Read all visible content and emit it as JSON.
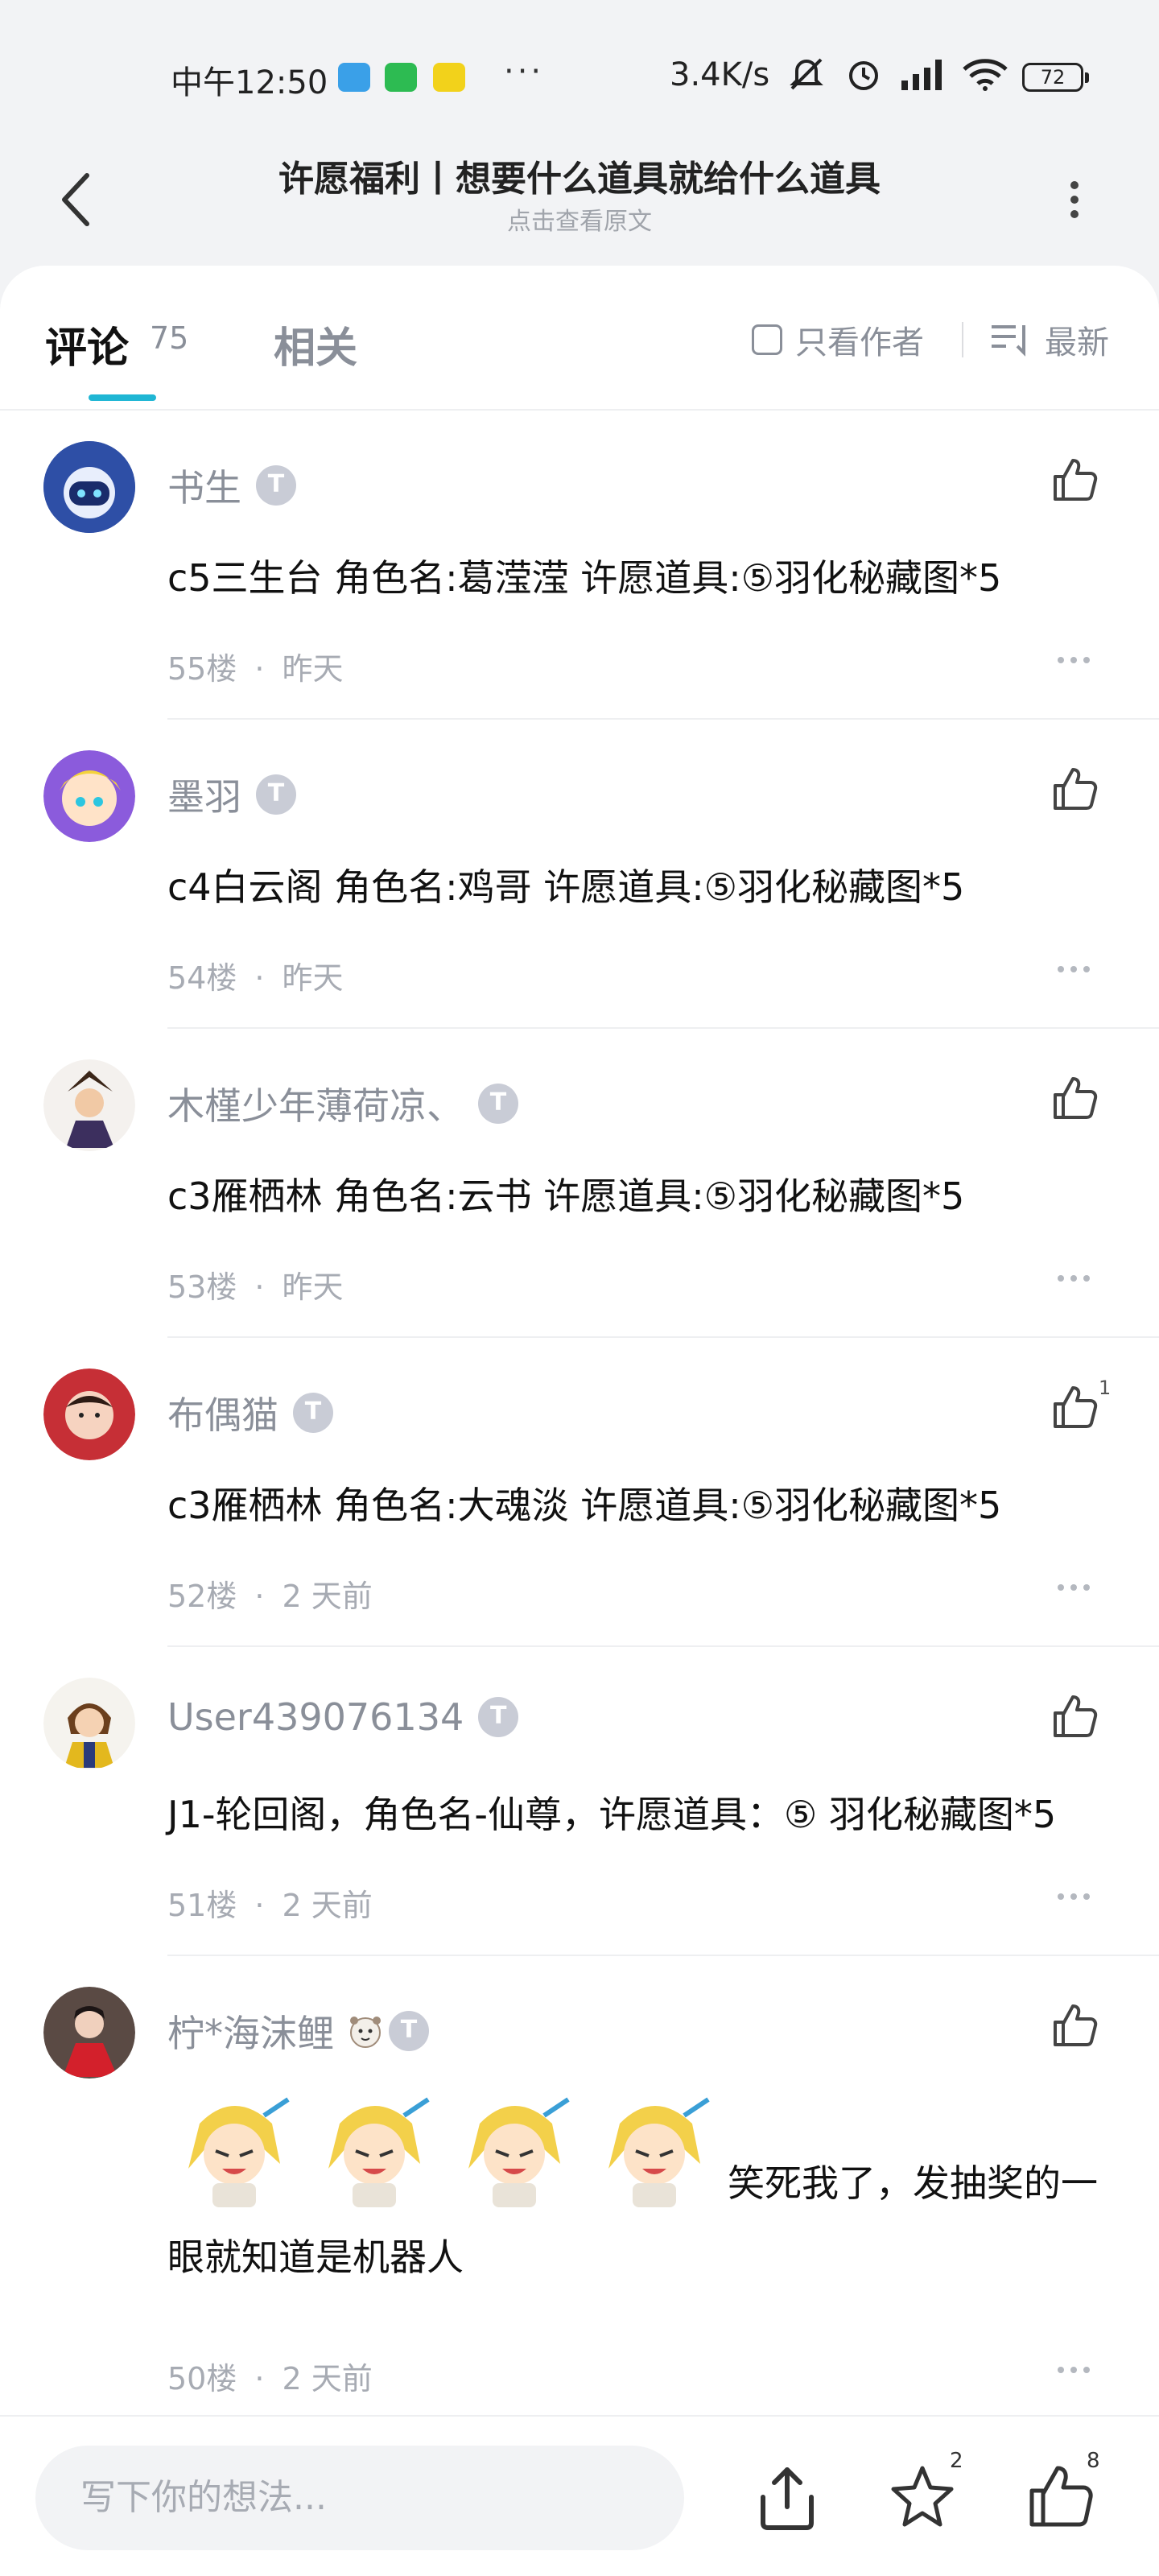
{
  "status_bar": {
    "time": "中午12:50",
    "dots": "···",
    "network_speed": "3.4K/s",
    "battery": "72"
  },
  "header": {
    "title": "许愿福利丨想要什么道具就给什么道具",
    "subtitle": "点击查看原文"
  },
  "tabs": {
    "comments_label": "评论",
    "comments_count": "75",
    "related_label": "相关",
    "author_only_label": "只看作者",
    "sort_label": "最新"
  },
  "comments": [
    {
      "user": "书生",
      "text": "c5三生台 角色名:葛滢滢  许愿道具:⑤羽化秘藏图*5",
      "floor": "55楼",
      "time": "昨天",
      "likes": ""
    },
    {
      "user": "墨羽",
      "text": "c4白云阁 角色名:鸡哥  许愿道具:⑤羽化秘藏图*5",
      "floor": "54楼",
      "time": "昨天",
      "likes": ""
    },
    {
      "user": "木槿少年薄荷凉、",
      "text": "c3雁栖林 角色名:云书  许愿道具:⑤羽化秘藏图*5",
      "floor": "53楼",
      "time": "昨天",
      "likes": ""
    },
    {
      "user": "布偶猫",
      "text": "c3雁栖林 角色名:大魂淡  许愿道具:⑤羽化秘藏图*5",
      "floor": "52楼",
      "time": "2 天前",
      "likes": "1"
    },
    {
      "user": "User439076134",
      "text": "J1-轮回阁，角色名-仙尊，许愿道具：⑤ 羽化秘藏图*5",
      "floor": "51楼",
      "time": "2 天前",
      "likes": ""
    },
    {
      "user": "柠*海沫鲤",
      "text": "笑死我了，发抽奖的一眼就知道是机器人",
      "floor": "50楼",
      "time": "2 天前",
      "likes": ""
    }
  ],
  "bottom_bar": {
    "input_placeholder": "写下你的想法...",
    "star_count": "2",
    "like_count": "8"
  },
  "colors": {
    "accent": "#1fb6d4",
    "muted_text": "#8a8f99",
    "background": "#f2f3f5"
  },
  "icons": [
    "back-icon",
    "more-vertical-icon",
    "checkbox-icon",
    "sort-icon",
    "thumbs-up-icon",
    "more-horizontal-icon",
    "share-icon",
    "star-icon"
  ]
}
